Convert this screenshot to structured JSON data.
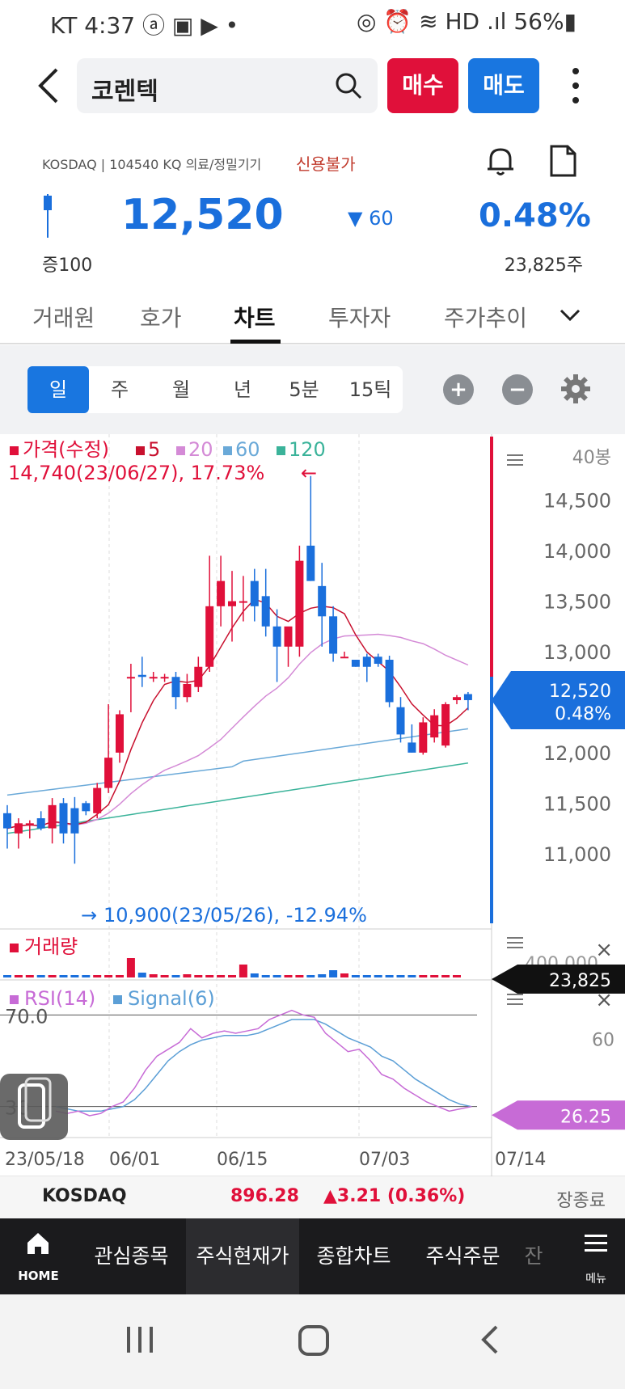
{
  "status_bar": {
    "left": "KT  4:37  ⓐ ▣ ▶ •",
    "right": "◎ ⏰ ≋ HD .ıl 56%▮"
  },
  "header": {
    "stock_name": "코렌텍",
    "buy_label": "매수",
    "sell_label": "매도"
  },
  "info": {
    "market_line": "KOSDAQ | 104540 KQ 의료/정밀기기",
    "credit_status": "신용불가",
    "price": "12,520",
    "change": "60",
    "change_pct": "0.48%",
    "margin": "증100",
    "volume": "23,825주"
  },
  "tabs": [
    "거래원",
    "호가",
    "차트",
    "투자자",
    "주가추이"
  ],
  "active_tab": "차트",
  "periods": [
    "일",
    "주",
    "월",
    "년",
    "5분",
    "15틱"
  ],
  "active_period": "일",
  "colors": {
    "up": "#e0103a",
    "down": "#1a6fdc",
    "rsi": "#c76bd6",
    "signal": "#5c9fd6",
    "ma5": "#c8102e",
    "ma20": "#d48ad6",
    "ma60": "#6aa9d8",
    "ma120": "#3bb39a"
  },
  "chart_data": {
    "type": "candlestick",
    "price_legend": {
      "label": "가격(수정)",
      "ma": [
        "5",
        "20",
        "60",
        "120"
      ]
    },
    "bars_count_label": "40봉",
    "high_annotation": "14,740(23/06/27), 17.73%",
    "low_annotation": "10,900(23/05/26), -12.94%",
    "y_ticks": [
      "14,500",
      "14,000",
      "13,500",
      "13,000",
      "12,000",
      "11,500",
      "11,000"
    ],
    "ylim": [
      10750,
      14850
    ],
    "current_price_label": "12,520",
    "current_pct_label": "0.48%",
    "candles": [
      {
        "o": 11400,
        "h": 11480,
        "l": 11050,
        "c": 11250
      },
      {
        "o": 11200,
        "h": 11350,
        "l": 11050,
        "c": 11300
      },
      {
        "o": 11300,
        "h": 11330,
        "l": 11150,
        "c": 11300
      },
      {
        "o": 11350,
        "h": 11420,
        "l": 11230,
        "c": 11250
      },
      {
        "o": 11250,
        "h": 11550,
        "l": 11100,
        "c": 11480
      },
      {
        "o": 11500,
        "h": 11550,
        "l": 11100,
        "c": 11200
      },
      {
        "o": 11450,
        "h": 11560,
        "l": 10900,
        "c": 11200
      },
      {
        "o": 11500,
        "h": 11520,
        "l": 11380,
        "c": 11420
      },
      {
        "o": 11400,
        "h": 11700,
        "l": 11350,
        "c": 11650
      },
      {
        "o": 11650,
        "h": 12480,
        "l": 11600,
        "c": 11950
      },
      {
        "o": 12000,
        "h": 12420,
        "l": 11900,
        "c": 12380
      },
      {
        "o": 12750,
        "h": 12880,
        "l": 12400,
        "c": 12750
      },
      {
        "o": 12770,
        "h": 12950,
        "l": 12650,
        "c": 12750
      },
      {
        "o": 12750,
        "h": 12800,
        "l": 12700,
        "c": 12750
      },
      {
        "o": 12750,
        "h": 12780,
        "l": 12700,
        "c": 12750
      },
      {
        "o": 12750,
        "h": 12800,
        "l": 12430,
        "c": 12550
      },
      {
        "o": 12550,
        "h": 12780,
        "l": 12500,
        "c": 12680
      },
      {
        "o": 12650,
        "h": 12950,
        "l": 12600,
        "c": 12850
      },
      {
        "o": 12850,
        "h": 13950,
        "l": 12800,
        "c": 13450
      },
      {
        "o": 13450,
        "h": 13950,
        "l": 13250,
        "c": 13700
      },
      {
        "o": 13450,
        "h": 13800,
        "l": 13100,
        "c": 13500
      },
      {
        "o": 13500,
        "h": 13750,
        "l": 13300,
        "c": 13500
      },
      {
        "o": 13700,
        "h": 13820,
        "l": 13300,
        "c": 13450
      },
      {
        "o": 13550,
        "h": 13820,
        "l": 13150,
        "c": 13250
      },
      {
        "o": 13250,
        "h": 13420,
        "l": 12700,
        "c": 13050
      },
      {
        "o": 13050,
        "h": 13200,
        "l": 12850,
        "c": 13250
      },
      {
        "o": 13050,
        "h": 14050,
        "l": 12950,
        "c": 13900
      },
      {
        "o": 14050,
        "h": 14740,
        "l": 13700,
        "c": 13700
      },
      {
        "o": 13650,
        "h": 13880,
        "l": 13050,
        "c": 13350
      },
      {
        "o": 13350,
        "h": 13450,
        "l": 12900,
        "c": 12980
      },
      {
        "o": 12950,
        "h": 13000,
        "l": 12950,
        "c": 12950
      },
      {
        "o": 12920,
        "h": 12920,
        "l": 12850,
        "c": 12850
      },
      {
        "o": 12950,
        "h": 12980,
        "l": 12700,
        "c": 12850
      },
      {
        "o": 12950,
        "h": 12980,
        "l": 12850,
        "c": 12880
      },
      {
        "o": 12920,
        "h": 12960,
        "l": 12450,
        "c": 12500
      },
      {
        "o": 12450,
        "h": 12550,
        "l": 12100,
        "c": 12180
      },
      {
        "o": 12100,
        "h": 12280,
        "l": 12000,
        "c": 12000
      },
      {
        "o": 12000,
        "h": 12350,
        "l": 11980,
        "c": 12300
      },
      {
        "o": 12150,
        "h": 12430,
        "l": 12100,
        "c": 12370
      },
      {
        "o": 12070,
        "h": 12500,
        "l": 12050,
        "c": 12480
      },
      {
        "o": 12520,
        "h": 12570,
        "l": 12480,
        "c": 12550
      },
      {
        "o": 12580,
        "h": 12600,
        "l": 12420,
        "c": 12520
      }
    ],
    "volume_legend": "거래량",
    "volume_axis_label": "400,000",
    "volume_current": "23,825",
    "rsi_legend": [
      "RSI(14)",
      "Signal(6)"
    ],
    "rsi_ticks": [
      "70.0",
      "60",
      "30"
    ],
    "rsi_current": "26.25",
    "rsi": [
      28,
      27,
      28,
      26,
      27,
      30,
      32,
      38,
      46,
      52,
      55,
      58,
      64,
      60,
      62,
      63,
      62,
      63,
      64,
      68,
      70,
      72,
      70,
      69,
      62,
      58,
      54,
      55,
      50,
      44,
      42,
      38,
      35,
      32,
      30,
      28,
      29,
      30,
      32,
      34,
      24
    ],
    "signal": [
      30,
      29,
      28,
      28,
      28,
      29,
      30,
      33,
      38,
      44,
      50,
      54,
      57,
      59,
      60,
      61,
      61,
      61,
      62,
      64,
      66,
      68,
      68,
      68,
      66,
      63,
      60,
      58,
      56,
      52,
      50,
      46,
      42,
      39,
      36,
      33,
      31,
      30,
      30,
      31,
      27
    ],
    "x_labels": [
      "23/05/18",
      "06/01",
      "06/15",
      "07/03",
      "07/14"
    ]
  },
  "kosdaq_bar": {
    "name": "KOSDAQ",
    "value": "896.28",
    "change": "▲3.21 (0.36%)",
    "status": "장종료"
  },
  "bottom_nav": {
    "home": "HOME",
    "items": [
      "관심종목",
      "주식현재가",
      "종합차트",
      "주식주문",
      "잔"
    ],
    "menu": "메뉴",
    "active": "주식현재가"
  }
}
